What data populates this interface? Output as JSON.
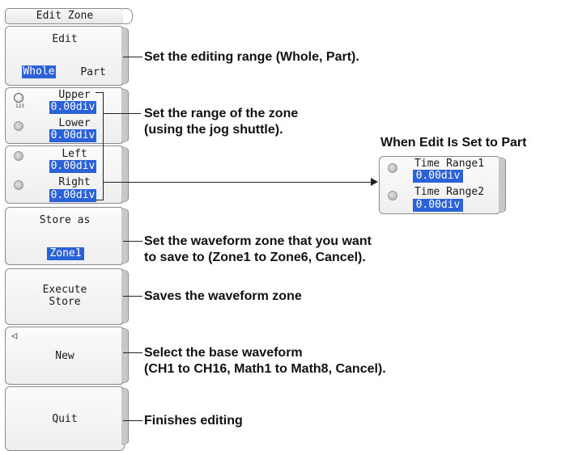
{
  "menu": {
    "title": "Edit Zone",
    "edit": {
      "label": "Edit",
      "option_whole": "Whole",
      "option_part": "Part"
    },
    "range": {
      "upper_label": "Upper",
      "upper_value": "0.00div",
      "lower_label": "Lower",
      "lower_value": "0.00div",
      "left_label": "Left",
      "left_value": "0.00div",
      "right_label": "Right",
      "right_value": "0.00div",
      "jog_badge": "123"
    },
    "store_as": {
      "label": "Store as",
      "value": "Zone1"
    },
    "execute_store": {
      "line1": "Execute",
      "line2": "Store"
    },
    "new": {
      "label": "New",
      "arrow": "◁"
    },
    "quit": {
      "label": "Quit"
    }
  },
  "part_panel": {
    "heading": "When Edit Is Set to Part",
    "time_range1_label": "Time Range1",
    "time_range1_value": "0.00div",
    "time_range2_label": "Time Range2",
    "time_range2_value": "0.00div"
  },
  "annotations": {
    "edit": "Set the editing range (Whole, Part).",
    "range_line1": "Set the range of the zone",
    "range_line2": "(using the jog shuttle).",
    "store_line1": "Set the waveform zone that you want",
    "store_line2": "to save to (Zone1 to Zone6, Cancel).",
    "execute": "Saves the waveform zone",
    "new_line1": "Select the base waveform",
    "new_line2": "(CH1 to CH16, Math1 to Math8, Cancel).",
    "quit": "Finishes editing"
  }
}
